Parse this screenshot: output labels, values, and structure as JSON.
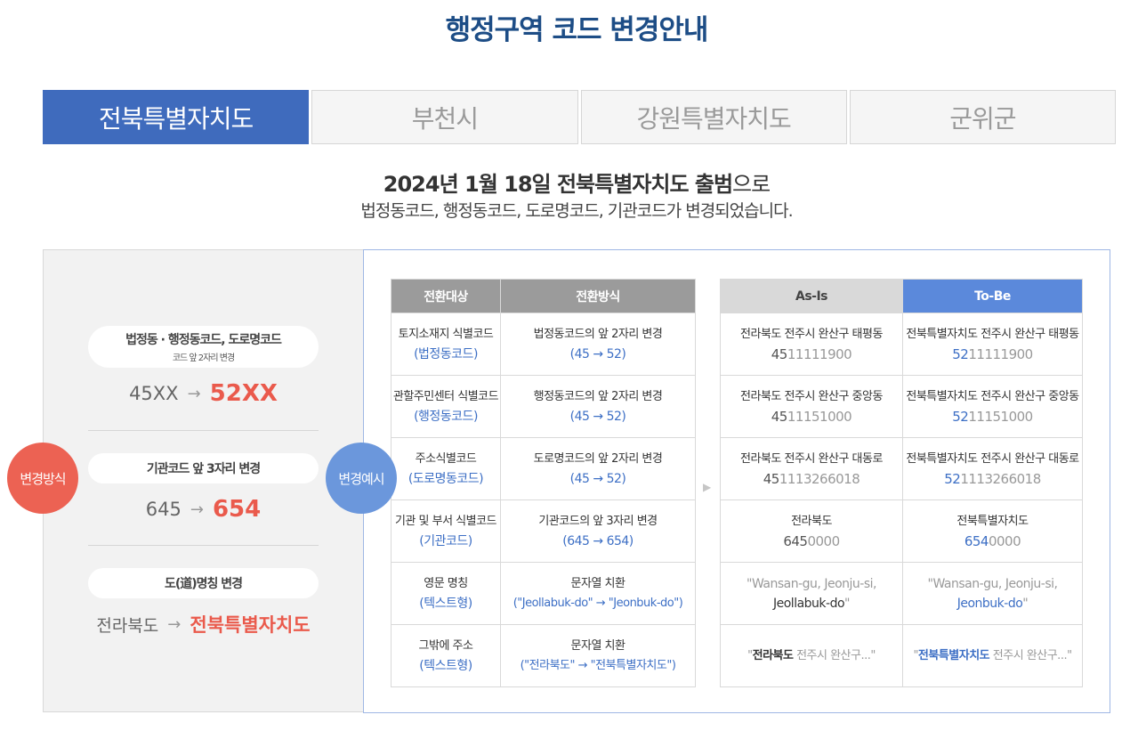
{
  "title": "행정구역 코드 변경안내",
  "tabs": [
    "전북특별자치도",
    "부천시",
    "강원특별자치도",
    "군위군"
  ],
  "active_tab": "전북특별자치도",
  "intro": {
    "bold": "2024년 1월 18일 전북특별자치도 출범",
    "suffix": "으로",
    "sub": "법정동코드, 행정동코드, 도로명코드, 기관코드가 변경되었습니다."
  },
  "method_label": "변경방식",
  "example_label": "변경예시",
  "methods": [
    {
      "title": "법정동 · 행정동코드, 도로명코드",
      "sub": "코드 앞 2자리 변경",
      "old": "45XX",
      "arrow": "→",
      "new": "52XX"
    },
    {
      "title": "기관코드 앞 3자리 변경",
      "sub": "",
      "old": "645",
      "arrow": "→",
      "new": "654"
    },
    {
      "title": "도(道)명칭 변경",
      "sub": "",
      "old": "전라북도",
      "arrow": "→",
      "new": "전북특별자치도"
    }
  ],
  "table1": {
    "headers": [
      "전환대상",
      "전환방식"
    ],
    "rows": [
      {
        "target": "토지소재지 식별코드",
        "target_type": "(법정동코드)",
        "method": "법정동코드의 앞 2자리 변경",
        "method_detail": "(45 → 52)"
      },
      {
        "target": "관할주민센터 식별코드",
        "target_type": "(행정동코드)",
        "method": "행정동코드의 앞 2자리 변경",
        "method_detail": "(45 → 52)"
      },
      {
        "target": "주소식별코드",
        "target_type": "(도로명동코드)",
        "method": "도로명코드의 앞 2자리 변경",
        "method_detail": "(45 → 52)"
      },
      {
        "target": "기관 및 부서 식별코드",
        "target_type": "(기관코드)",
        "method": "기관코드의 앞 3자리 변경",
        "method_detail": "(645 → 654)"
      },
      {
        "target": "영문 명칭",
        "target_type": "(텍스트형)",
        "method": "문자열 치환",
        "method_detail": "(\"Jeollabuk-do\" → \"Jeonbuk-do\")"
      },
      {
        "target": "그밖에 주소",
        "target_type": "(텍스트형)",
        "method": "문자열 치환",
        "method_detail": "(\"전라북도\" → \"전북특별자치도\")"
      }
    ]
  },
  "mid_arrow": "▶",
  "table2": {
    "headers": [
      "As-Is",
      "To-Be"
    ],
    "rows": [
      {
        "asis_name": "전라북도 전주시 완산구 태평동",
        "asis_pre": "45",
        "asis_rest": "11111900",
        "tobe_name": "전북특별자치도 전주시 완산구 태평동",
        "tobe_pre": "52",
        "tobe_rest": "11111900"
      },
      {
        "asis_name": "전라북도 전주시 완산구 중앙동",
        "asis_pre": "45",
        "asis_rest": "11151000",
        "tobe_name": "전북특별자치도 전주시 완산구 중앙동",
        "tobe_pre": "52",
        "tobe_rest": "11151000"
      },
      {
        "asis_name": "전라북도 전주시 완산구 대동로",
        "asis_pre": "45",
        "asis_rest": "1113266018",
        "tobe_name": "전북특별자치도 전주시 완산구 대동로",
        "tobe_pre": "52",
        "tobe_rest": "1113266018"
      },
      {
        "asis_name": "전라북도",
        "asis_pre": "645",
        "asis_rest": "0000",
        "tobe_name": "전북특별자치도",
        "tobe_pre": "654",
        "tobe_rest": "0000"
      }
    ],
    "english": {
      "asis_a": "\"Wansan-gu, Jeonju-si,",
      "asis_b": "Jeollabuk-do",
      "asis_c": "\"",
      "tobe_a": "\"Wansan-gu, Jeonju-si,",
      "tobe_b": "Jeonbuk-do",
      "tobe_c": "\""
    },
    "address": {
      "asis_q1": "\"",
      "asis_b": "전라북도",
      "asis_rest": " 전주시 완산구...\"",
      "tobe_q1": "\"",
      "tobe_b": "전북특별자치도",
      "tobe_rest": " 전주시 완산구...\""
    }
  }
}
